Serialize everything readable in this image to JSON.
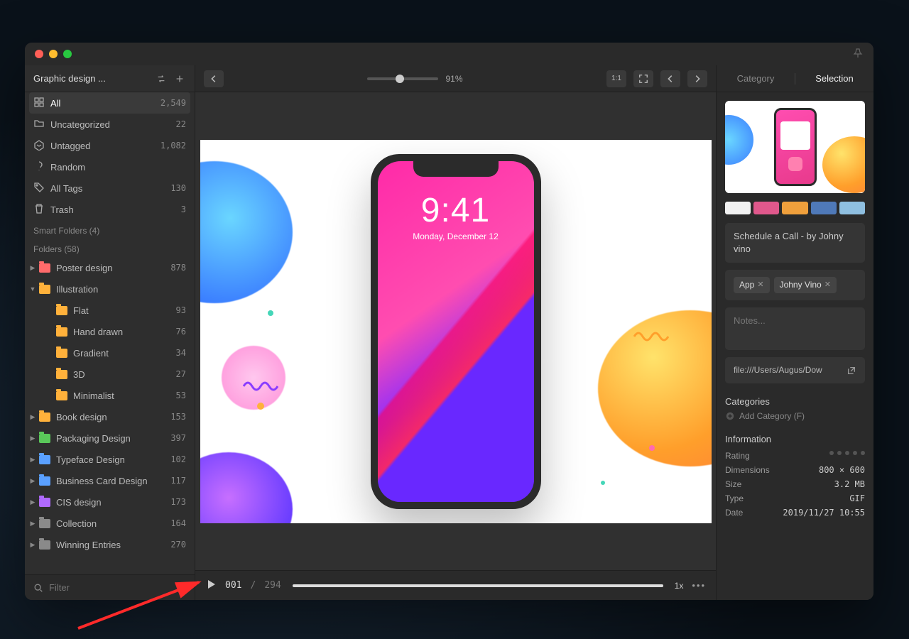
{
  "sidebar": {
    "title": "Graphic design ...",
    "smart": [
      {
        "icon": "all",
        "label": "All",
        "count": "2,549",
        "active": true
      },
      {
        "icon": "uncat",
        "label": "Uncategorized",
        "count": "22"
      },
      {
        "icon": "untag",
        "label": "Untagged",
        "count": "1,082"
      },
      {
        "icon": "random",
        "label": "Random",
        "count": ""
      },
      {
        "icon": "tags",
        "label": "All Tags",
        "count": "130"
      },
      {
        "icon": "trash",
        "label": "Trash",
        "count": "3"
      }
    ],
    "smart_folders_label": "Smart Folders (4)",
    "folders_label": "Folders (58)",
    "folders": [
      {
        "label": "Poster design",
        "count": "878",
        "color": "#ff6b6b",
        "depth": 0,
        "expanded": false
      },
      {
        "label": "Illustration",
        "count": "",
        "color": "#ffb13b",
        "depth": 0,
        "expanded": true
      },
      {
        "label": "Flat",
        "count": "93",
        "color": "#ffb13b",
        "depth": 1
      },
      {
        "label": "Hand drawn",
        "count": "76",
        "color": "#ffb13b",
        "depth": 1
      },
      {
        "label": "Gradient",
        "count": "34",
        "color": "#ffb13b",
        "depth": 1
      },
      {
        "label": "3D",
        "count": "27",
        "color": "#ffb13b",
        "depth": 1
      },
      {
        "label": "Minimalist",
        "count": "53",
        "color": "#ffb13b",
        "depth": 1
      },
      {
        "label": "Book design",
        "count": "153",
        "color": "#ffb13b",
        "depth": 0,
        "expanded": false
      },
      {
        "label": "Packaging Design",
        "count": "397",
        "color": "#5ac85a",
        "depth": 0,
        "expanded": false
      },
      {
        "label": "Typeface Design",
        "count": "102",
        "color": "#5aa0ff",
        "depth": 0,
        "expanded": false
      },
      {
        "label": "Business Card Design",
        "count": "117",
        "color": "#5aa0ff",
        "depth": 0,
        "expanded": false
      },
      {
        "label": "CIS design",
        "count": "173",
        "color": "#b06aff",
        "depth": 0,
        "expanded": false
      },
      {
        "label": "Collection",
        "count": "164",
        "color": "#8a8a8a",
        "depth": 0,
        "expanded": false
      },
      {
        "label": "Winning Entries",
        "count": "270",
        "color": "#8a8a8a",
        "depth": 0,
        "expanded": false
      }
    ],
    "filter_placeholder": "Filter"
  },
  "toolbar": {
    "zoom_pct": "91%",
    "zoom_pos": 0.4
  },
  "preview": {
    "phone_time": "9:41",
    "phone_date": "Monday, December 12"
  },
  "playbar": {
    "current": "001",
    "sep": "/",
    "total": "294",
    "progress": 1.0,
    "speed": "1x"
  },
  "inspector": {
    "tabs": {
      "category": "Category",
      "selection": "Selection"
    },
    "gif_badge": "GIF",
    "palette": [
      "#f2f2f2",
      "#e0588c",
      "#f0a03c",
      "#4f79b8",
      "#8fbfe0"
    ],
    "title": "Schedule a Call - by Johny vino",
    "tags": [
      "App",
      "Johny Vino"
    ],
    "notes_placeholder": "Notes...",
    "url": "file:///Users/Augus/Dow",
    "categories_label": "Categories",
    "add_category": "Add Category (F)",
    "information_label": "Information",
    "info": {
      "rating_label": "Rating",
      "dimensions_label": "Dimensions",
      "dimensions": "800 × 600",
      "size_label": "Size",
      "size": "3.2 MB",
      "type_label": "Type",
      "type": "GIF",
      "date_label": "Date",
      "date": "2019/11/27 10:55"
    }
  }
}
